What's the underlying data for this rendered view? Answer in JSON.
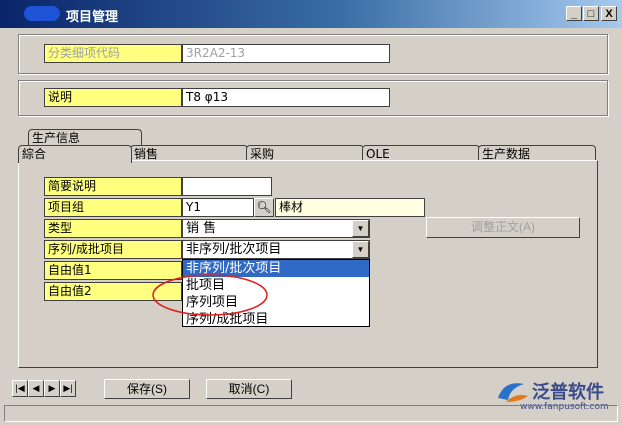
{
  "window": {
    "title": "项目管理"
  },
  "titlebar_buttons": {
    "minimize": "_",
    "maximize": "□",
    "close": "X"
  },
  "top_fields": {
    "classification_label": "分类细项代码",
    "classification_value": "3R2A2-13",
    "description_label": "说明",
    "description_value": "T8 φ13"
  },
  "tabs": {
    "production": "生产信息",
    "general": "綜合",
    "sales": "销售",
    "purchase": "采购",
    "ole": "OLE",
    "production_data": "生产数据"
  },
  "form": {
    "summary_label": "简要说明",
    "summary_value": "",
    "item_group_label": "项目组",
    "item_group_code": "Y1",
    "item_group_name": "棒材",
    "type_label": "类型",
    "type_value": "销 售",
    "serial_label": "序列/成批项目",
    "serial_value": "非序列/批次项目",
    "free1_label": "自由值1",
    "free2_label": "自由值2"
  },
  "dropdown_options": [
    "非序列/批次项目",
    "批项目",
    "序列项目",
    "序列/成批项目"
  ],
  "buttons": {
    "adjust_text": "调整正文(A)",
    "save": "保存(S)",
    "cancel": "取消(C)"
  },
  "nav": {
    "first": "|◀",
    "prev": "◀",
    "next": "▶",
    "last": "▶|"
  },
  "logo": {
    "name": "泛普软件",
    "url": "www.fanpusoft.com"
  },
  "colors": {
    "label_bg": "#ffff80",
    "selection": "#316ac5",
    "annotation": "#e02020"
  }
}
